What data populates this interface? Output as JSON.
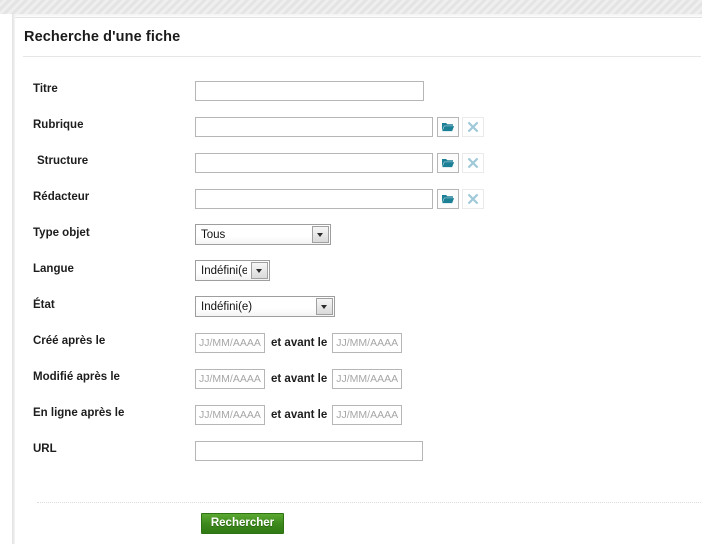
{
  "page": {
    "title": "Recherche d'une fiche"
  },
  "form": {
    "rows": [
      {
        "key": "titre",
        "label": "Titre",
        "type": "text",
        "value": "",
        "placeholder": ""
      },
      {
        "key": "rubrique",
        "label": "Rubrique",
        "type": "picker",
        "value": "",
        "placeholder": "",
        "browse_icon": "folder-open-icon",
        "clear_icon": "clear-x-icon"
      },
      {
        "key": "structure",
        "label": "Structure",
        "type": "picker",
        "value": "",
        "placeholder": "",
        "browse_icon": "folder-open-icon",
        "clear_icon": "clear-x-icon"
      },
      {
        "key": "redacteur",
        "label": "Rédacteur",
        "type": "picker",
        "value": "",
        "placeholder": "",
        "browse_icon": "folder-open-icon",
        "clear_icon": "clear-x-icon"
      },
      {
        "key": "type_objet",
        "label": "Type objet",
        "type": "select",
        "value": "Tous",
        "options": [
          "Tous"
        ]
      },
      {
        "key": "langue",
        "label": "Langue",
        "type": "select",
        "value": "Indéfini(e)",
        "options": [
          "Indéfini(e)"
        ]
      },
      {
        "key": "etat",
        "label": "État",
        "type": "select",
        "value": "Indéfini(e)",
        "options": [
          "Indéfini(e)"
        ]
      },
      {
        "key": "cree",
        "label": "Créé après le",
        "type": "date_range",
        "from_value": "",
        "from_placeholder": "JJ/MM/AAAA",
        "between_label": "et avant le",
        "to_value": "",
        "to_placeholder": "JJ/MM/AAAA"
      },
      {
        "key": "modifie",
        "label": "Modifié après le",
        "type": "date_range",
        "from_value": "",
        "from_placeholder": "JJ/MM/AAAA",
        "between_label": "et avant le",
        "to_value": "",
        "to_placeholder": "JJ/MM/AAAA"
      },
      {
        "key": "en_ligne",
        "label": "En ligne après le",
        "type": "date_range",
        "from_value": "",
        "from_placeholder": "JJ/MM/AAAA",
        "between_label": "et avant le",
        "to_value": "",
        "to_placeholder": "JJ/MM/AAAA"
      },
      {
        "key": "url",
        "label": "URL",
        "type": "text",
        "value": "",
        "placeholder": ""
      }
    ],
    "submit_label": "Rechercher"
  },
  "colors": {
    "submit_green": "#3e8a1d",
    "folder_icon_teal": "#1b7f96",
    "clear_icon_blue": "#9fc8d8",
    "input_border": "#b6b6b6",
    "title_text": "#1b1b1b"
  }
}
